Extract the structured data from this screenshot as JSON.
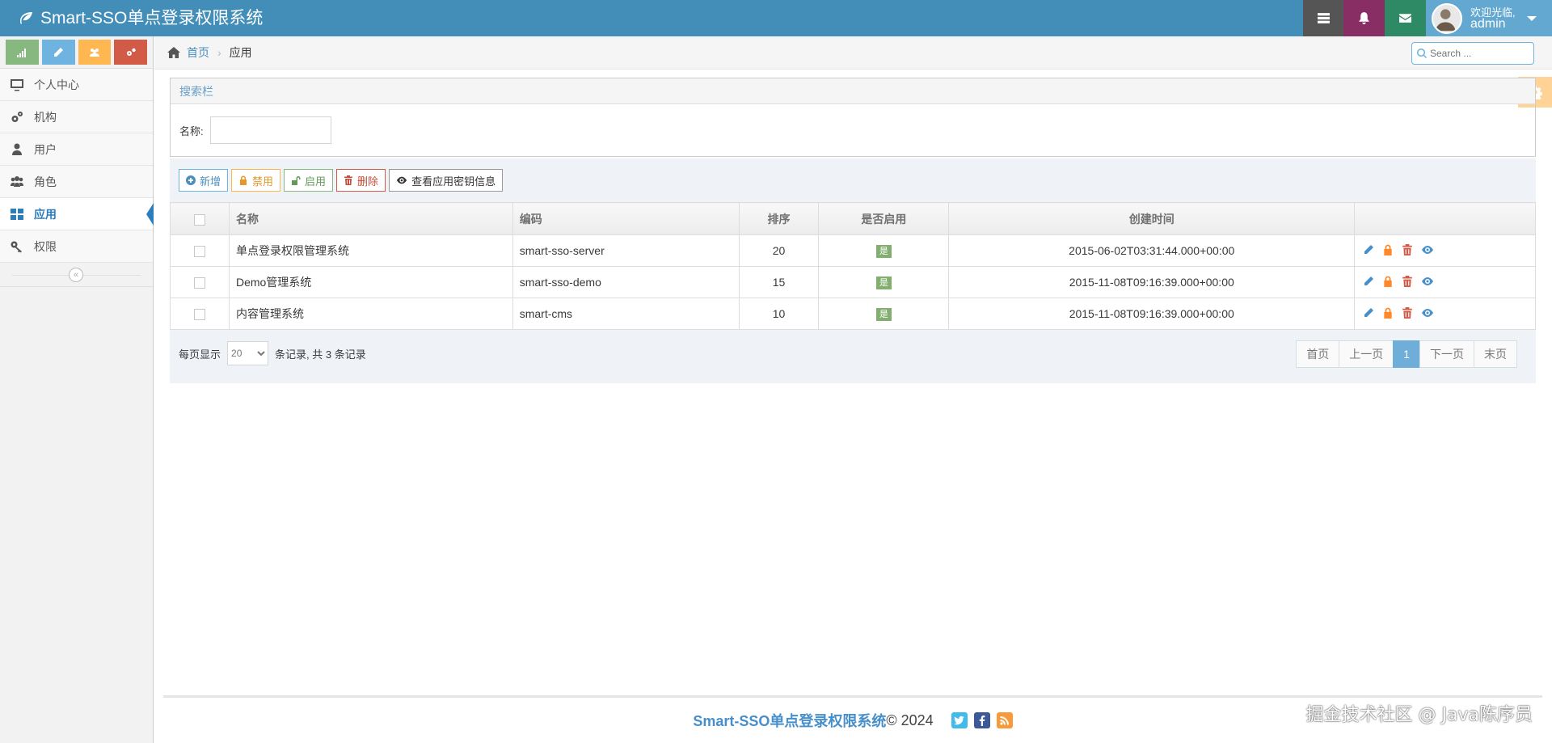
{
  "navbar": {
    "brand": "Smart-SSO单点登录权限系统",
    "welcome": "欢迎光临,",
    "username": "admin"
  },
  "sidebar": {
    "items": [
      {
        "label": "个人中心",
        "icon": "desktop-icon"
      },
      {
        "label": "机构",
        "icon": "cogs-icon"
      },
      {
        "label": "用户",
        "icon": "user-icon"
      },
      {
        "label": "角色",
        "icon": "users-icon"
      },
      {
        "label": "应用",
        "icon": "grid-icon",
        "active": true
      },
      {
        "label": "权限",
        "icon": "key-icon"
      }
    ],
    "collapse": "«"
  },
  "breadcrumb": {
    "home": "首页",
    "sep": "›",
    "current": "应用"
  },
  "search": {
    "placeholder": "Search ..."
  },
  "filter_panel": {
    "title": "搜索栏",
    "name_label": "名称:"
  },
  "toolbar": {
    "add": "新增",
    "disable": "禁用",
    "enable": "启用",
    "delete": "删除",
    "view_secret": "查看应用密钥信息"
  },
  "table": {
    "headers": [
      "名称",
      "编码",
      "排序",
      "是否启用",
      "创建时间"
    ],
    "rows": [
      {
        "name": "单点登录权限管理系统",
        "code": "smart-sso-server",
        "sort": "20",
        "enabled": "是",
        "created": "2015-06-02T03:31:44.000+00:00"
      },
      {
        "name": "Demo管理系统",
        "code": "smart-sso-demo",
        "sort": "15",
        "enabled": "是",
        "created": "2015-11-08T09:16:39.000+00:00"
      },
      {
        "name": "内容管理系统",
        "code": "smart-cms",
        "sort": "10",
        "enabled": "是",
        "created": "2015-11-08T09:16:39.000+00:00"
      }
    ]
  },
  "pager": {
    "per_page_label": "每页显示",
    "page_size": "20",
    "records_label": "条记录, 共 3 条记录",
    "first": "首页",
    "prev": "上一页",
    "current": "1",
    "next": "下一页",
    "last": "末页"
  },
  "footer": {
    "brand": "Smart-SSO单点登录权限系统",
    "copyright": " © 2024"
  },
  "watermark": "掘金技术社区 @ Java陈序员",
  "colors": {
    "navbar": "#438eb9",
    "accent": "#2b7dbc"
  }
}
